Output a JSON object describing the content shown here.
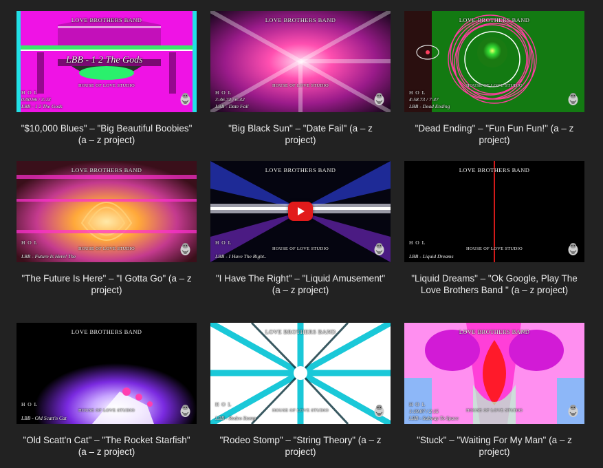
{
  "overlay": {
    "band": "LOVE BROTHERS BAND",
    "studio": "HOUSE OF LOVE STUDIO",
    "hol": "H O L"
  },
  "player": {
    "play_button_icon": "youtube-play-icon"
  },
  "videos": [
    {
      "title": "\"$10,000 Blues\" – \"Big Beautiful Boobies\" (a – z project)",
      "thumb_title": "LBB - 1 2 The Gods",
      "time": "0:00.96 / 3:13",
      "subtitle": "LBB - 1 2 The Gods"
    },
    {
      "title": "\"Big Black Sun\" – \"Date Fail\" (a – z project)",
      "time": "3:46.72 / 6:42",
      "subtitle": "LBB - Date Fail"
    },
    {
      "title": "\"Dead Ending\" – \"Fun Fun Fun!\" (a – z project)",
      "time": "4:58.73 / 7:47",
      "subtitle": "LBB - Dead Ending"
    },
    {
      "title": "\"The Future Is Here\" – \"I Gotta Go\" (a – z project)",
      "subtitle": "LBB - Future Is Here! The"
    },
    {
      "title": "\"I Have The Right\" – \"Liquid Amusement\" (a – z project)",
      "subtitle": "LBB - I Have The Right.."
    },
    {
      "title": "\"Liquid Dreams\" – \"Ok Google, Play The Love Brothers Band \" (a – z project)",
      "subtitle": "LBB - Liquid Dreams"
    },
    {
      "title": "\"Old Scatt'n Cat\" – \"The Rocket Starfish\" (a – z project)",
      "subtitle": "LBB - Old Scatt'n Cat"
    },
    {
      "title": "\"Rodeo Stomp\" – \"String Theory\" (a – z project)",
      "subtitle": "LBB - Rodeo Stomp"
    },
    {
      "title": "\"Stuck\" – \"Waiting For My Man\" (a – z project)",
      "time": "1:19.07 / 2:15",
      "subtitle": "LBB - Subway To Space"
    }
  ]
}
